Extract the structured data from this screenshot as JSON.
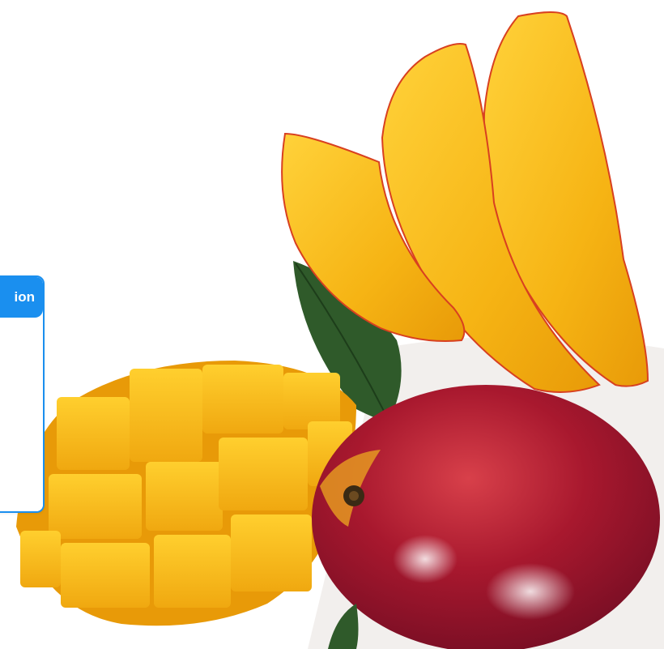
{
  "panel": {
    "header_label": "ion"
  },
  "photo": {
    "subject": "mango-fruit-photo",
    "colors": {
      "flesh": "#f7b818",
      "flesh_shadow": "#e89a08",
      "skin_red": "#a8182e",
      "leaf": "#2f5a2a",
      "accent": "#1a8fef"
    }
  }
}
